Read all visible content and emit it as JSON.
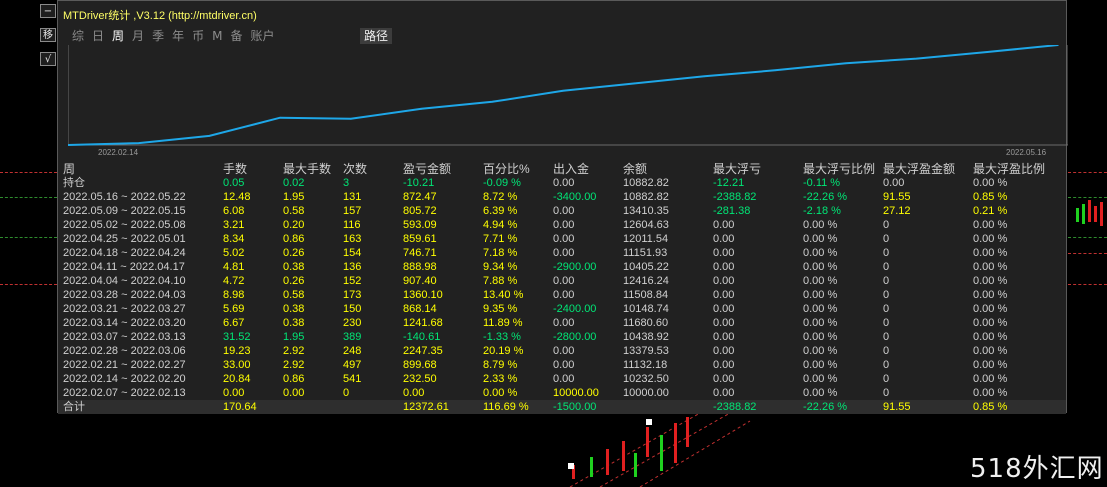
{
  "window": {
    "title": "MTDriver统计 ,V3.12 (http://mtdriver.cn)"
  },
  "side_buttons": {
    "minimize": "−",
    "move": "移",
    "check": "√"
  },
  "tabs": [
    {
      "label": "综",
      "active": false
    },
    {
      "label": "日",
      "active": false
    },
    {
      "label": "周",
      "active": true
    },
    {
      "label": "月",
      "active": false
    },
    {
      "label": "季",
      "active": false
    },
    {
      "label": "年",
      "active": false
    },
    {
      "label": "币",
      "active": false
    },
    {
      "label": "M",
      "active": false
    },
    {
      "label": "备",
      "active": false
    },
    {
      "label": "账户",
      "active": false
    }
  ],
  "path_tab": "路径",
  "chart_data": {
    "type": "line",
    "x_start_label": "2022.02.14",
    "x_end_label": "2022.05.16",
    "x": [
      "2022.02.07",
      "2022.02.14",
      "2022.02.21",
      "2022.02.28",
      "2022.03.07",
      "2022.03.14",
      "2022.03.21",
      "2022.03.28",
      "2022.04.04",
      "2022.04.11",
      "2022.04.18",
      "2022.04.25",
      "2022.05.02",
      "2022.05.09",
      "2022.05.16"
    ],
    "values": [
      10000.0,
      10232.5,
      11132.18,
      13379.53,
      13239.07,
      14480.75,
      15348.89,
      16709.02,
      17616.42,
      18505.4,
      19252.05,
      20111.66,
      20704.75,
      21510.47,
      22382.94
    ],
    "ylim": [
      10000,
      22383
    ],
    "color": "#1ea7e8"
  },
  "table": {
    "headers": [
      "周",
      "手数",
      "最大手数",
      "次数",
      "盈亏金额",
      "百分比%",
      "出入金",
      "余额",
      "最大浮亏",
      "最大浮亏比例",
      "最大浮盈金额",
      "最大浮盈比例"
    ],
    "holding": {
      "label": "持仓",
      "lots": "0.05",
      "max_lots": "0.02",
      "count": "3",
      "pl": "-10.21",
      "pct": "-0.09 %",
      "io": "0.00",
      "balance": "10882.82",
      "max_float_loss": "-12.21",
      "max_float_loss_pct": "-0.11 %",
      "max_float_profit": "0.00",
      "max_float_profit_pct": "0.00 %"
    },
    "rows": [
      {
        "period": "2022.05.16 ~ 2022.05.22",
        "lots": "12.48",
        "max_lots": "1.95",
        "count": "131",
        "pl": "872.47",
        "pct": "8.72 %",
        "io": "-3400.00",
        "balance": "10882.82",
        "mfl": "-2388.82",
        "mflp": "-22.26 %",
        "mfp": "91.55",
        "mfpp": "0.85 %"
      },
      {
        "period": "2022.05.09 ~ 2022.05.15",
        "lots": "6.08",
        "max_lots": "0.58",
        "count": "157",
        "pl": "805.72",
        "pct": "6.39 %",
        "io": "0.00",
        "balance": "13410.35",
        "mfl": "-281.38",
        "mflp": "-2.18 %",
        "mfp": "27.12",
        "mfpp": "0.21 %"
      },
      {
        "period": "2022.05.02 ~ 2022.05.08",
        "lots": "3.21",
        "max_lots": "0.20",
        "count": "116",
        "pl": "593.09",
        "pct": "4.94 %",
        "io": "0.00",
        "balance": "12604.63",
        "mfl": "0.00",
        "mflp": "0.00 %",
        "mfp": "0",
        "mfpp": "0.00 %"
      },
      {
        "period": "2022.04.25 ~ 2022.05.01",
        "lots": "8.34",
        "max_lots": "0.86",
        "count": "163",
        "pl": "859.61",
        "pct": "7.71 %",
        "io": "0.00",
        "balance": "12011.54",
        "mfl": "0.00",
        "mflp": "0.00 %",
        "mfp": "0",
        "mfpp": "0.00 %"
      },
      {
        "period": "2022.04.18 ~ 2022.04.24",
        "lots": "5.02",
        "max_lots": "0.26",
        "count": "154",
        "pl": "746.71",
        "pct": "7.18 %",
        "io": "0.00",
        "balance": "11151.93",
        "mfl": "0.00",
        "mflp": "0.00 %",
        "mfp": "0",
        "mfpp": "0.00 %"
      },
      {
        "period": "2022.04.11 ~ 2022.04.17",
        "lots": "4.81",
        "max_lots": "0.38",
        "count": "136",
        "pl": "888.98",
        "pct": "9.34 %",
        "io": "-2900.00",
        "balance": "10405.22",
        "mfl": "0.00",
        "mflp": "0.00 %",
        "mfp": "0",
        "mfpp": "0.00 %"
      },
      {
        "period": "2022.04.04 ~ 2022.04.10",
        "lots": "4.72",
        "max_lots": "0.26",
        "count": "152",
        "pl": "907.40",
        "pct": "7.88 %",
        "io": "0.00",
        "balance": "12416.24",
        "mfl": "0.00",
        "mflp": "0.00 %",
        "mfp": "0",
        "mfpp": "0.00 %"
      },
      {
        "period": "2022.03.28 ~ 2022.04.03",
        "lots": "8.98",
        "max_lots": "0.58",
        "count": "173",
        "pl": "1360.10",
        "pct": "13.40 %",
        "io": "0.00",
        "balance": "11508.84",
        "mfl": "0.00",
        "mflp": "0.00 %",
        "mfp": "0",
        "mfpp": "0.00 %"
      },
      {
        "period": "2022.03.21 ~ 2022.03.27",
        "lots": "5.69",
        "max_lots": "0.38",
        "count": "150",
        "pl": "868.14",
        "pct": "9.35 %",
        "io": "-2400.00",
        "balance": "10148.74",
        "mfl": "0.00",
        "mflp": "0.00 %",
        "mfp": "0",
        "mfpp": "0.00 %"
      },
      {
        "period": "2022.03.14 ~ 2022.03.20",
        "lots": "6.67",
        "max_lots": "0.38",
        "count": "230",
        "pl": "1241.68",
        "pct": "11.89 %",
        "io": "0.00",
        "balance": "11680.60",
        "mfl": "0.00",
        "mflp": "0.00 %",
        "mfp": "0",
        "mfpp": "0.00 %"
      },
      {
        "period": "2022.03.07 ~ 2022.03.13",
        "lots": "31.52",
        "max_lots": "1.95",
        "count": "389",
        "pl": "-140.61",
        "pct": "-1.33 %",
        "io": "-2800.00",
        "balance": "10438.92",
        "mfl": "0.00",
        "mflp": "0.00 %",
        "mfp": "0",
        "mfpp": "0.00 %"
      },
      {
        "period": "2022.02.28 ~ 2022.03.06",
        "lots": "19.23",
        "max_lots": "2.92",
        "count": "248",
        "pl": "2247.35",
        "pct": "20.19 %",
        "io": "0.00",
        "balance": "13379.53",
        "mfl": "0.00",
        "mflp": "0.00 %",
        "mfp": "0",
        "mfpp": "0.00 %"
      },
      {
        "period": "2022.02.21 ~ 2022.02.27",
        "lots": "33.00",
        "max_lots": "2.92",
        "count": "497",
        "pl": "899.68",
        "pct": "8.79 %",
        "io": "0.00",
        "balance": "11132.18",
        "mfl": "0.00",
        "mflp": "0.00 %",
        "mfp": "0",
        "mfpp": "0.00 %"
      },
      {
        "period": "2022.02.14 ~ 2022.02.20",
        "lots": "20.84",
        "max_lots": "0.86",
        "count": "541",
        "pl": "232.50",
        "pct": "2.33 %",
        "io": "0.00",
        "balance": "10232.50",
        "mfl": "0.00",
        "mflp": "0.00 %",
        "mfp": "0",
        "mfpp": "0.00 %"
      },
      {
        "period": "2022.02.07 ~ 2022.02.13",
        "lots": "0.00",
        "max_lots": "0.00",
        "count": "0",
        "pl": "0.00",
        "pct": "0.00 %",
        "io": "10000.00",
        "balance": "10000.00",
        "mfl": "0.00",
        "mflp": "0.00 %",
        "mfp": "0",
        "mfpp": "0.00 %"
      }
    ],
    "total": {
      "label": "合计",
      "lots": "170.64",
      "pl": "12372.61",
      "pct": "116.69 %",
      "io": "-1500.00",
      "mfl": "-2388.82",
      "mflp": "-22.26 %",
      "mfp": "91.55",
      "mfpp": "0.85 %"
    }
  },
  "colors": {
    "yellow": "#ffff00",
    "green": "#00e676",
    "line": "#1ea7e8",
    "panel": "#212121"
  },
  "watermark": "518外汇网"
}
